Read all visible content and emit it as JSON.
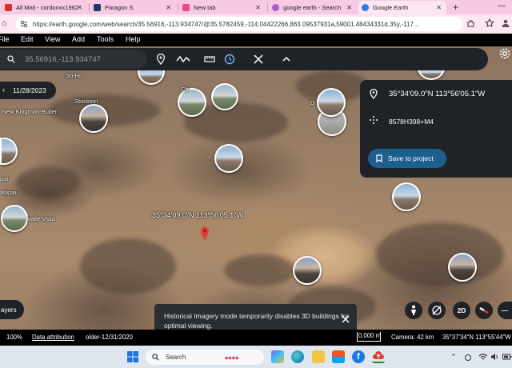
{
  "browser": {
    "tabs": [
      {
        "title": "All Mail - cordonxx1962",
        "active": false,
        "favicon_color": "#d93025"
      },
      {
        "title": "Paragon S",
        "active": false,
        "favicon_color": "#1a3a6b"
      },
      {
        "title": "New tab",
        "active": false,
        "favicon_color": "#e84a8a"
      },
      {
        "title": "google earth - Search",
        "active": false,
        "favicon_color": "#a45dd6"
      },
      {
        "title": "Google Earth",
        "active": true,
        "favicon_color": "#2b7de9"
      }
    ],
    "new_tab_label": "+",
    "minimize_label": "—",
    "url": "https://earth.google.com/web/search/35.56916,-113.934747/@35.5782459,-114.04422266,863.09537931a,59001.48434331d,35y,-117...",
    "accent_color": "#f7c9e3"
  },
  "menu": {
    "items": [
      "File",
      "Edit",
      "View",
      "Add",
      "Tools",
      "Help"
    ]
  },
  "search": {
    "value": "35.56916,-113.934747",
    "toolbar_icons": [
      "location-pin-icon",
      "path-icon",
      "ruler-icon",
      "history-icon",
      "tools-icon",
      "collapse-icon"
    ]
  },
  "map": {
    "date": "11/28/2023",
    "places": [
      "So-Hi",
      "Stockton",
      "New Kingman-Butler",
      "Valle Vista",
      "Dolan Springs"
    ],
    "partial_places": [
      "Ch",
      "D",
      "pai",
      "alapai"
    ],
    "coord_label": "35°34'09.0\"N 113°56'05.1\"W",
    "marker_color": "#e53935"
  },
  "info_panel": {
    "coords": "35°34'09.0\"N 113°56'05.1\"W",
    "plus_code": "8578H398+M4",
    "save_button": "Save to project"
  },
  "controls": {
    "layers_label": "ayers",
    "view_2d_label": "2D",
    "corner_glyph": "—"
  },
  "toast": {
    "message": "Historical Imagery mode temporarily disables 3D buildings for optimal viewing."
  },
  "status": {
    "zoom": "100%",
    "attribution": "Data attribution",
    "imagery": "older-12/31/2020",
    "scale": "0,000 m",
    "camera": "Camera: 42 km",
    "cursor_coords": "35°37'34\"N 113°55'44\"W"
  },
  "taskbar": {
    "search_placeholder": "Search",
    "apps": [
      "widgets-icon",
      "copilot-icon",
      "edge-icon",
      "file-explorer-icon",
      "store-icon",
      "facebook-icon",
      "cloud-upload-icon"
    ]
  }
}
